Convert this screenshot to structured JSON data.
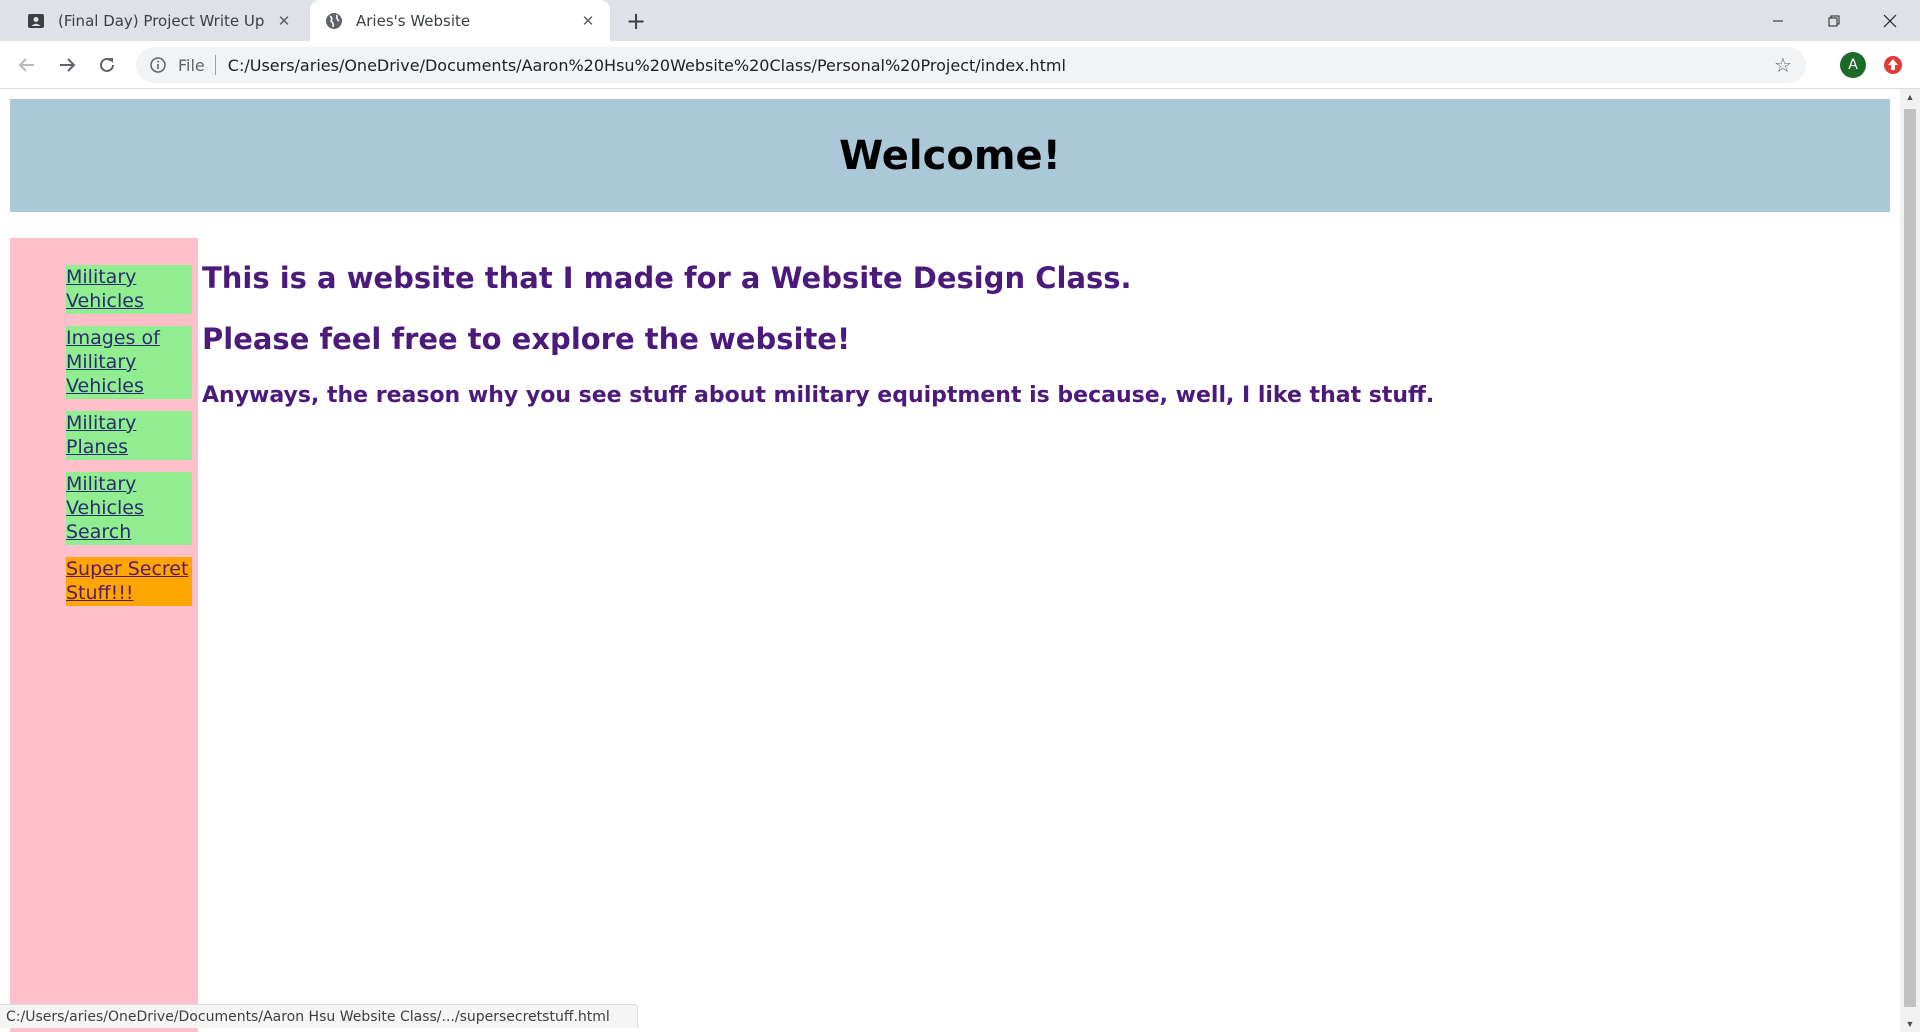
{
  "browser": {
    "tabs": [
      {
        "title": "(Final Day) Project Write Up",
        "icon": "classroom-icon",
        "active": false
      },
      {
        "title": "Aries's Website",
        "icon": "globe-icon",
        "active": true
      }
    ],
    "new_tab_glyph": "+",
    "address": {
      "scheme_label": "File",
      "url": "C:/Users/aries/OneDrive/Documents/Aaron%20Hsu%20Website%20Class/Personal%20Project/index.html"
    },
    "profile_initial": "A",
    "status_url": "C:/Users/aries/OneDrive/Documents/Aaron Hsu Website Class/.../supersecretstuff.html"
  },
  "page": {
    "header_title": "Welcome!",
    "nav": [
      {
        "label": "Military Vehicles",
        "style": "green"
      },
      {
        "label": "Images of Military Vehicles",
        "style": "green"
      },
      {
        "label": "Military Planes",
        "style": "green"
      },
      {
        "label": "Military Vehicles Search",
        "style": "green"
      },
      {
        "label": "Super Secret Stuff!!!",
        "style": "orange"
      }
    ],
    "heading_1": "This is a website that I made for a Website Design Class.",
    "heading_2": "Please feel free to explore the website!",
    "paragraph": "Anyways, the reason why you see stuff about military equiptment is because, well, I like that stuff."
  },
  "colors": {
    "header_bg": "#abc8d8",
    "sidebar_bg": "#ffc0cb",
    "nav_green": "#90ee90",
    "nav_orange": "#ffa500",
    "content_text": "#4b1a7a"
  }
}
